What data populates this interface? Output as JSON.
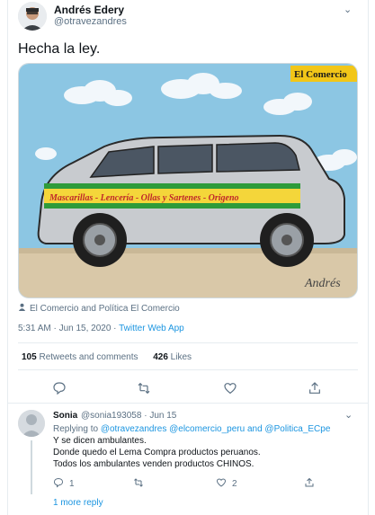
{
  "tweet": {
    "author_name": "Andrés Edery",
    "author_handle": "@otravezandres",
    "text": "Hecha la ley.",
    "image": {
      "logo_text": "El Comercio",
      "van_text": "Mascarillas - Lencería - Ollas y Sartenes - Origeno",
      "signature": "Andrés"
    },
    "tagged": "El Comercio and Política El Comercio",
    "timestamp": "5:31 AM · Jun 15, 2020 · ",
    "source": "Twitter Web App",
    "retweets_count": "105",
    "retweets_label": "Retweets and comments",
    "likes_count": "426",
    "likes_label": "Likes",
    "actions": [
      "reply-icon",
      "retweet-icon",
      "like-icon",
      "share-icon"
    ]
  },
  "reply": {
    "name": "Sonia",
    "handle": "@sonia193058 · Jun 15",
    "replying_prefix": "Replying to ",
    "replying_handles": "@otravezandres @elcomercio_peru and @Politica_ECpe",
    "lines": [
      "Y se dicen ambulantes.",
      "Donde quedo el Lema Compra productos peruanos.",
      "Todos los ambulantes venden productos CHINOS."
    ],
    "reply_count": "1",
    "like_count": "2",
    "more_replies": "1 more reply"
  },
  "colors": {
    "accent": "#1b95e0",
    "secondary_text": "#5b7083",
    "border": "#e6ecf0"
  }
}
